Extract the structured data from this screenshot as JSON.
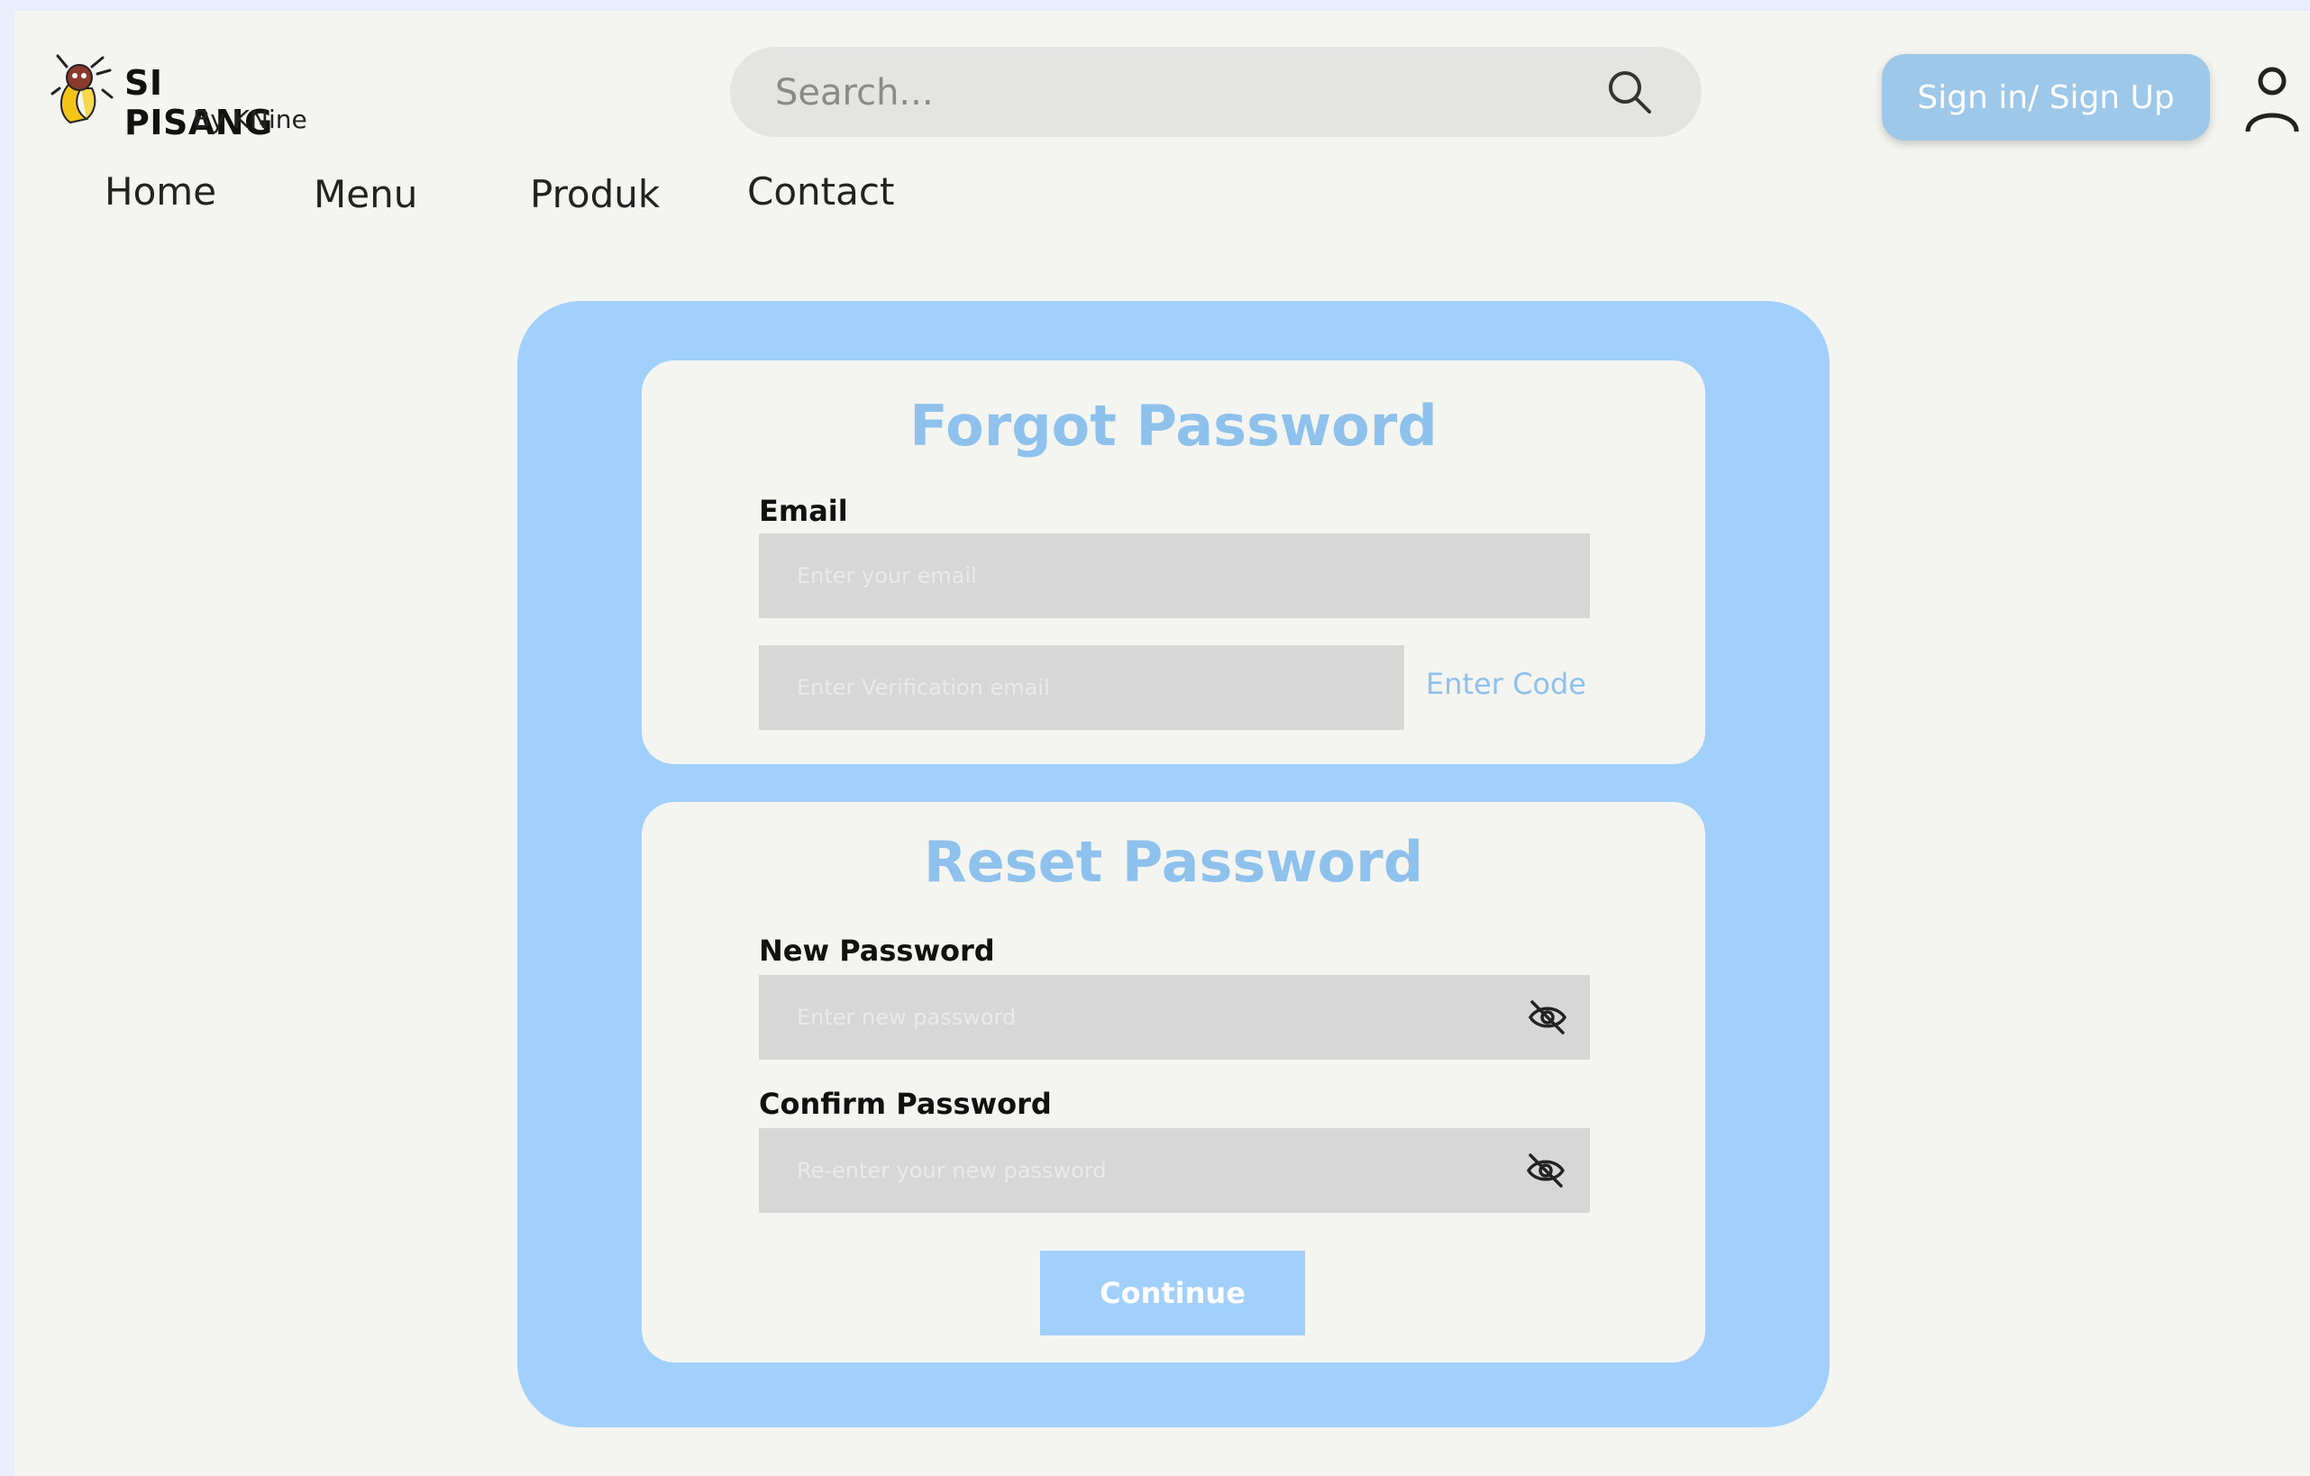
{
  "brand": {
    "name": "SI PISANG",
    "subtitle": "By KNine"
  },
  "search": {
    "placeholder": "Search..."
  },
  "header": {
    "signin_label": "Sign in/ Sign Up"
  },
  "nav": {
    "items": [
      "Home",
      "Menu",
      "Produk",
      "Contact"
    ]
  },
  "forgot": {
    "title": "Forgot Password",
    "email_label": "Email",
    "email_placeholder": "Enter your email",
    "code_placeholder": "Enter Verification email",
    "code_link": "Enter Code"
  },
  "reset": {
    "title": "Reset Password",
    "new_label": "New Password",
    "new_placeholder": "Enter new password",
    "confirm_label": "Confirm Password",
    "confirm_placeholder": "Re-enter your new password",
    "continue_label": "Continue"
  },
  "colors": {
    "accent": "#a1d0fc",
    "title": "#8ec2ec",
    "button": "#9ec8ea",
    "background": "#f4f4f0"
  },
  "icons": [
    "banana-logo-icon",
    "search-icon",
    "user-icon",
    "eye-off-icon"
  ]
}
